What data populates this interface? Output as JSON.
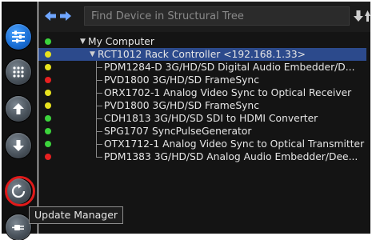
{
  "search": {
    "placeholder": "Find Device in Structural Tree"
  },
  "sidebar": {
    "buttons": [
      {
        "icon": "sliders-icon",
        "active": true
      },
      {
        "icon": "grid-icon"
      },
      {
        "icon": "upload-icon"
      },
      {
        "icon": "download-icon"
      },
      {
        "icon": "refresh-icon",
        "highlighted": true
      },
      {
        "icon": "plug-icon"
      }
    ]
  },
  "tooltip": {
    "text": "Update Manager"
  },
  "tree": {
    "root": {
      "label": "My Computer",
      "status": "#3cd33c"
    },
    "controller": {
      "label": "RCT1012 Rack Controller <192.168.1.33>",
      "status": "#e8e21e"
    },
    "devices": [
      {
        "label": "PDM1284-D 3G/HD/SD Digital Audio Embedder/D...",
        "status": "#e8e21e"
      },
      {
        "label": "PVD1800 3G/HD/SD FrameSync",
        "status": "#e62020"
      },
      {
        "label": "ORX1702-1 Analog Video Sync to Optical Receiver",
        "status": "#e8e21e"
      },
      {
        "label": "PVD1800 3G/HD/SD FrameSync",
        "status": "#e8e21e"
      },
      {
        "label": "CDH1813 3G/HD/SD SDI to HDMI Converter",
        "status": "#3cd33c"
      },
      {
        "label": "SPG1707 SyncPulseGenerator",
        "status": "#3cd33c"
      },
      {
        "label": "OTX1712-1 Analog Video Sync to Optical Transmitter",
        "status": "#3cd33c"
      },
      {
        "label": "PDM1383 3G/HD/SD Analog Audio Embedder/Dee...",
        "status": "#e62020"
      }
    ]
  },
  "colors": {
    "sidebar_bg": "#101010",
    "panel_bg": "#141414",
    "selection": "#2c4a8c",
    "highlight_ring": "#e01a1a"
  }
}
